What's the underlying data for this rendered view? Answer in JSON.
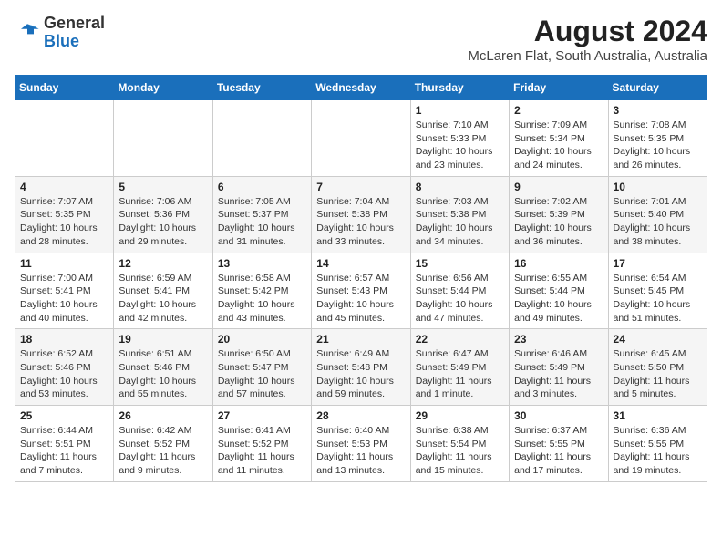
{
  "header": {
    "logo_general": "General",
    "logo_blue": "Blue",
    "title": "August 2024",
    "subtitle": "McLaren Flat, South Australia, Australia"
  },
  "weekdays": [
    "Sunday",
    "Monday",
    "Tuesday",
    "Wednesday",
    "Thursday",
    "Friday",
    "Saturday"
  ],
  "weeks": [
    [
      {
        "day": "",
        "info": ""
      },
      {
        "day": "",
        "info": ""
      },
      {
        "day": "",
        "info": ""
      },
      {
        "day": "",
        "info": ""
      },
      {
        "day": "1",
        "info": "Sunrise: 7:10 AM\nSunset: 5:33 PM\nDaylight: 10 hours\nand 23 minutes."
      },
      {
        "day": "2",
        "info": "Sunrise: 7:09 AM\nSunset: 5:34 PM\nDaylight: 10 hours\nand 24 minutes."
      },
      {
        "day": "3",
        "info": "Sunrise: 7:08 AM\nSunset: 5:35 PM\nDaylight: 10 hours\nand 26 minutes."
      }
    ],
    [
      {
        "day": "4",
        "info": "Sunrise: 7:07 AM\nSunset: 5:35 PM\nDaylight: 10 hours\nand 28 minutes."
      },
      {
        "day": "5",
        "info": "Sunrise: 7:06 AM\nSunset: 5:36 PM\nDaylight: 10 hours\nand 29 minutes."
      },
      {
        "day": "6",
        "info": "Sunrise: 7:05 AM\nSunset: 5:37 PM\nDaylight: 10 hours\nand 31 minutes."
      },
      {
        "day": "7",
        "info": "Sunrise: 7:04 AM\nSunset: 5:38 PM\nDaylight: 10 hours\nand 33 minutes."
      },
      {
        "day": "8",
        "info": "Sunrise: 7:03 AM\nSunset: 5:38 PM\nDaylight: 10 hours\nand 34 minutes."
      },
      {
        "day": "9",
        "info": "Sunrise: 7:02 AM\nSunset: 5:39 PM\nDaylight: 10 hours\nand 36 minutes."
      },
      {
        "day": "10",
        "info": "Sunrise: 7:01 AM\nSunset: 5:40 PM\nDaylight: 10 hours\nand 38 minutes."
      }
    ],
    [
      {
        "day": "11",
        "info": "Sunrise: 7:00 AM\nSunset: 5:41 PM\nDaylight: 10 hours\nand 40 minutes."
      },
      {
        "day": "12",
        "info": "Sunrise: 6:59 AM\nSunset: 5:41 PM\nDaylight: 10 hours\nand 42 minutes."
      },
      {
        "day": "13",
        "info": "Sunrise: 6:58 AM\nSunset: 5:42 PM\nDaylight: 10 hours\nand 43 minutes."
      },
      {
        "day": "14",
        "info": "Sunrise: 6:57 AM\nSunset: 5:43 PM\nDaylight: 10 hours\nand 45 minutes."
      },
      {
        "day": "15",
        "info": "Sunrise: 6:56 AM\nSunset: 5:44 PM\nDaylight: 10 hours\nand 47 minutes."
      },
      {
        "day": "16",
        "info": "Sunrise: 6:55 AM\nSunset: 5:44 PM\nDaylight: 10 hours\nand 49 minutes."
      },
      {
        "day": "17",
        "info": "Sunrise: 6:54 AM\nSunset: 5:45 PM\nDaylight: 10 hours\nand 51 minutes."
      }
    ],
    [
      {
        "day": "18",
        "info": "Sunrise: 6:52 AM\nSunset: 5:46 PM\nDaylight: 10 hours\nand 53 minutes."
      },
      {
        "day": "19",
        "info": "Sunrise: 6:51 AM\nSunset: 5:46 PM\nDaylight: 10 hours\nand 55 minutes."
      },
      {
        "day": "20",
        "info": "Sunrise: 6:50 AM\nSunset: 5:47 PM\nDaylight: 10 hours\nand 57 minutes."
      },
      {
        "day": "21",
        "info": "Sunrise: 6:49 AM\nSunset: 5:48 PM\nDaylight: 10 hours\nand 59 minutes."
      },
      {
        "day": "22",
        "info": "Sunrise: 6:47 AM\nSunset: 5:49 PM\nDaylight: 11 hours\nand 1 minute."
      },
      {
        "day": "23",
        "info": "Sunrise: 6:46 AM\nSunset: 5:49 PM\nDaylight: 11 hours\nand 3 minutes."
      },
      {
        "day": "24",
        "info": "Sunrise: 6:45 AM\nSunset: 5:50 PM\nDaylight: 11 hours\nand 5 minutes."
      }
    ],
    [
      {
        "day": "25",
        "info": "Sunrise: 6:44 AM\nSunset: 5:51 PM\nDaylight: 11 hours\nand 7 minutes."
      },
      {
        "day": "26",
        "info": "Sunrise: 6:42 AM\nSunset: 5:52 PM\nDaylight: 11 hours\nand 9 minutes."
      },
      {
        "day": "27",
        "info": "Sunrise: 6:41 AM\nSunset: 5:52 PM\nDaylight: 11 hours\nand 11 minutes."
      },
      {
        "day": "28",
        "info": "Sunrise: 6:40 AM\nSunset: 5:53 PM\nDaylight: 11 hours\nand 13 minutes."
      },
      {
        "day": "29",
        "info": "Sunrise: 6:38 AM\nSunset: 5:54 PM\nDaylight: 11 hours\nand 15 minutes."
      },
      {
        "day": "30",
        "info": "Sunrise: 6:37 AM\nSunset: 5:55 PM\nDaylight: 11 hours\nand 17 minutes."
      },
      {
        "day": "31",
        "info": "Sunrise: 6:36 AM\nSunset: 5:55 PM\nDaylight: 11 hours\nand 19 minutes."
      }
    ]
  ]
}
